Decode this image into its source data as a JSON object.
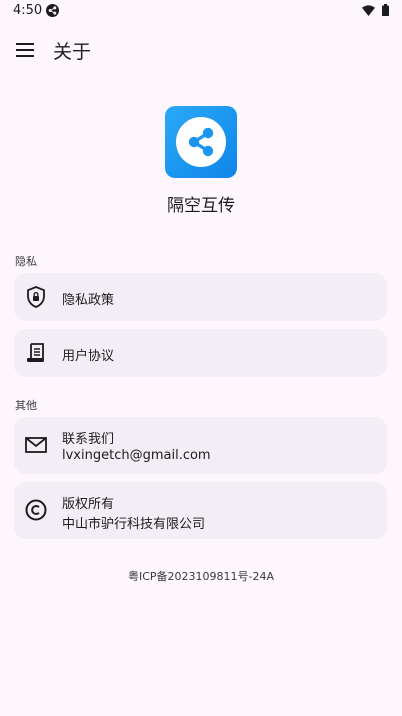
{
  "status_bar": {
    "time": "4:50"
  },
  "app_bar": {
    "title": "关于"
  },
  "app": {
    "name": "隔空互传"
  },
  "sections": {
    "privacy": "隐私",
    "other": "其他"
  },
  "items": {
    "privacy_policy": {
      "title": "隐私政策",
      "icon": "shield-lock-icon"
    },
    "user_agreement": {
      "title": "用户协议",
      "icon": "document-scroll-icon"
    },
    "contact": {
      "title": "联系我们",
      "subtitle": "lvxingetch@gmail.com",
      "icon": "mail-icon"
    },
    "copyright": {
      "title": "版权所有",
      "subtitle": "中山市驴行科技有限公司",
      "icon": "copyright-icon"
    }
  },
  "footer": {
    "icp": "粤ICP备2023109811号-24A"
  },
  "colors": {
    "background": "#fdf7fd",
    "card": "#f3eef5",
    "logo_blue": "#1a96f0"
  }
}
